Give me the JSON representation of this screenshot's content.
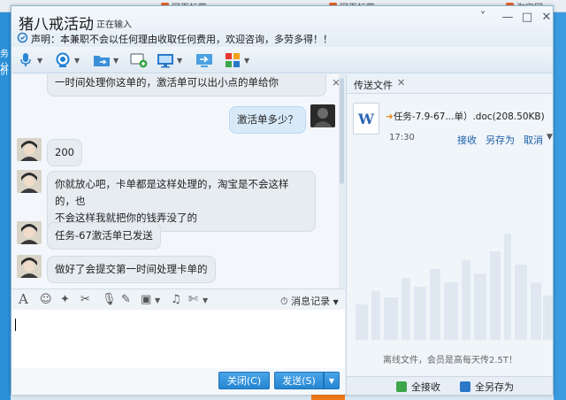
{
  "background_tabs": [
    "",
    "网页标签",
    "网页标签",
    "淘宝网"
  ],
  "background_left_labels": [
    "务分",
    "价"
  ],
  "window": {
    "title": "猪八戒活动",
    "status": "正在输入",
    "notice": "声明：本兼职不会以任何理由收取任何费用，欢迎咨询，多劳多得！！",
    "controls": [
      "˅",
      "—",
      "□",
      "✕"
    ]
  },
  "toolbar": {
    "items": [
      {
        "icon": "microphone-icon",
        "color": "#2c86d6"
      },
      {
        "icon": "webcam-icon",
        "color": "#1f7fd4"
      },
      {
        "icon": "file-transfer-icon",
        "color": "#3a8fd8"
      },
      {
        "icon": "message-add-icon",
        "color": "#3da64a"
      },
      {
        "icon": "screen-share-icon",
        "color": "#2a78c8"
      },
      {
        "icon": "remote-desktop-icon",
        "color": "#4aa0e0"
      },
      {
        "icon": "apps-grid-icon",
        "color": "#e6382e"
      }
    ]
  },
  "chat": {
    "messages": [
      {
        "from": "other",
        "text": "一时间处理你这单的，激活单可以出小点的单给你"
      },
      {
        "from": "me",
        "text": "激活单多少？"
      },
      {
        "from": "other",
        "text": "200"
      },
      {
        "from": "other",
        "text": "你就放心吧，卡单都是这样处理的，淘宝是不会这样的，也"
      },
      {
        "from": "other",
        "text": "不会这样我就把你的钱弄没了的"
      },
      {
        "from": "other",
        "text": "任务-67激活单已发送"
      },
      {
        "from": "other",
        "text": "做好了会提交第一时间处理卡单的"
      }
    ]
  },
  "input_toolbar": {
    "icons": [
      "font-icon",
      "emoji-icon",
      "magic-icon",
      "screenshot-icon",
      "voice-icon",
      "edit-icon",
      "image-icon",
      "music-icon",
      "scissors-icon"
    ],
    "history_label": "消息记录"
  },
  "send_area": {
    "close_label": "关闭(C)",
    "send_label": "发送(S)"
  },
  "file_panel": {
    "tab_label": "传送文件",
    "file_icon_letter": "W",
    "file_name": "任务-7.9-67...单）.doc(208.50KB)",
    "time": "17:30",
    "receive_label": "接收",
    "save_as_label": "另存为",
    "cancel_label": "取消",
    "offline_tip": "离线文件，会员是高每天传2.5T！",
    "receive_all_label": "全接收",
    "save_all_label": "全另存为"
  }
}
